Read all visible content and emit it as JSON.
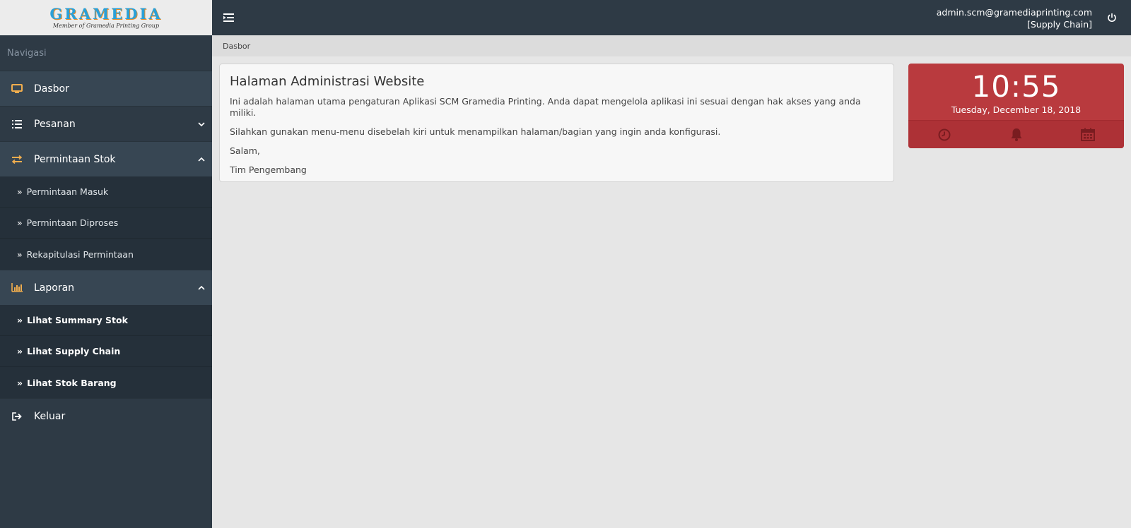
{
  "logo": {
    "name": "GRAMEDIA",
    "tagline": "Member of Gramedia Printing Group"
  },
  "sidebar": {
    "nav_title": "Navigasi",
    "dasbor": "Dasbor",
    "pesanan": "Pesanan",
    "permintaan_stok": {
      "label": "Permintaan Stok",
      "items": [
        "Permintaan Masuk",
        "Permintaan Diproses",
        "Rekapitulasi Permintaan"
      ]
    },
    "laporan": {
      "label": "Laporan",
      "items": [
        "Lihat Summary Stok",
        "Lihat Supply Chain",
        "Lihat Stok Barang"
      ]
    },
    "keluar": "Keluar"
  },
  "header": {
    "user_email": "admin.scm@gramediaprinting.com",
    "user_role": "[Supply Chain]"
  },
  "breadcrumb": "Dasbor",
  "main": {
    "title": "Halaman Administrasi Website",
    "paragraphs": [
      "Ini adalah halaman utama pengaturan Aplikasi SCM Gramedia Printing. Anda dapat mengelola aplikasi ini sesuai dengan hak akses yang anda miliki.",
      "Silahkan gunakan menu-menu disebelah kiri untuk menampilkan halaman/bagian yang ingin anda konfigurasi.",
      "Salam,",
      "Tim Pengembang"
    ]
  },
  "clock": {
    "time": "10:55",
    "date": "Tuesday, December 18, 2018",
    "icons": [
      "clock-icon",
      "bell-icon",
      "calendar-icon"
    ]
  },
  "colors": {
    "sidebar_bg": "#2e3a45",
    "accent_icon": "#f0ad4e",
    "clock_bg": "#b93a3e"
  }
}
